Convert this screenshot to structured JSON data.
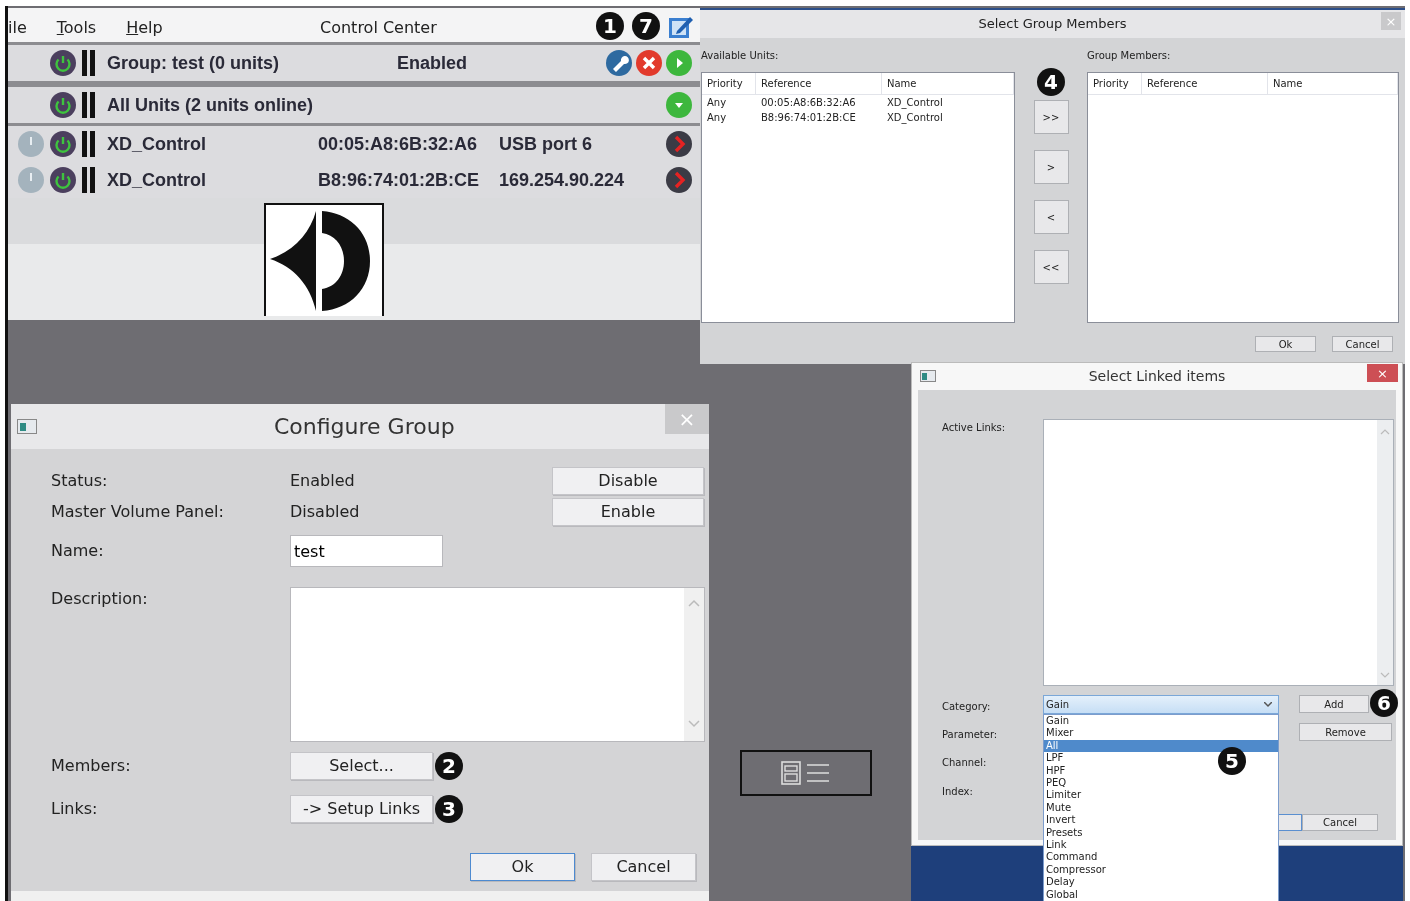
{
  "control_center": {
    "menu": [
      {
        "label": "ile",
        "mnemonic": false
      },
      {
        "label": "Tools",
        "mnemonic": true
      },
      {
        "label": "Help",
        "mnemonic": true
      }
    ],
    "title": "Control Center",
    "callouts": [
      "1",
      "7"
    ],
    "group_row": {
      "label": "Group: test (0 units)",
      "status": "Enabled"
    },
    "all_units_row": {
      "label": "All Units (2 units online)"
    },
    "units": [
      {
        "name": "XD_Control",
        "mac": "00:05:A8:6B:32:A6",
        "connection": "USB port 6"
      },
      {
        "name": "XD_Control",
        "mac": "B8:96:74:01:2B:CE",
        "connection": "169.254.90.224"
      }
    ]
  },
  "select_group_members": {
    "title": "Select Group Members",
    "available_label": "Available Units:",
    "members_label": "Group Members:",
    "available_columns": [
      "Priority",
      "Reference",
      "Name"
    ],
    "available_rows": [
      {
        "priority": "Any",
        "reference": "00:05:A8:6B:32:A6",
        "name": "XD_Control"
      },
      {
        "priority": "Any",
        "reference": "B8:96:74:01:2B:CE",
        "name": "XD_Control"
      }
    ],
    "member_columns": [
      "Priority",
      "Reference",
      "Name"
    ],
    "callout": "4",
    "close": "×",
    "move_buttons": [
      ">>",
      ">",
      "<",
      "<<"
    ],
    "buttons": [
      "Ok",
      "Cancel"
    ]
  },
  "configure_group": {
    "title": "Configure Group",
    "close": "×",
    "info": [
      {
        "label": "Status:",
        "value": "Enabled",
        "button": "Disable"
      },
      {
        "label": "Master Volume Panel:",
        "value": "Disabled",
        "button": "Enable"
      }
    ],
    "name_label": "Name:",
    "name_value": "test",
    "description_label": "Description:",
    "members_label": "Members:",
    "members_button": "Select...",
    "members_callout": "2",
    "links_label": "Links:",
    "links_button": "-> Setup Links",
    "links_callout": "3",
    "buttons": [
      "Ok",
      "Cancel"
    ]
  },
  "select_linked_items": {
    "title": "Select Linked items",
    "close": "×",
    "active_links_label": "Active Links:",
    "category_label": "Category:",
    "category_value": "Gain",
    "parameter_label": "Parameter:",
    "channel_label": "Channel:",
    "index_label": "Index:",
    "add_button": "Add",
    "add_callout": "6",
    "remove_button": "Remove",
    "cancel_button": "Cancel",
    "list_callout": "5",
    "options": [
      {
        "label": "Gain",
        "selected": false
      },
      {
        "label": "Mixer",
        "selected": false
      },
      {
        "label": "All",
        "selected": true
      },
      {
        "label": "LPF",
        "selected": false
      },
      {
        "label": "HPF",
        "selected": false
      },
      {
        "label": "PEQ",
        "selected": false
      },
      {
        "label": "Limiter",
        "selected": false
      },
      {
        "label": "Mute",
        "selected": false
      },
      {
        "label": "Invert",
        "selected": false
      },
      {
        "label": "Presets",
        "selected": false
      },
      {
        "label": "Link",
        "selected": false
      },
      {
        "label": "Command",
        "selected": false
      },
      {
        "label": "Compressor",
        "selected": false
      },
      {
        "label": "Delay",
        "selected": false
      },
      {
        "label": "Global",
        "selected": false
      }
    ]
  }
}
